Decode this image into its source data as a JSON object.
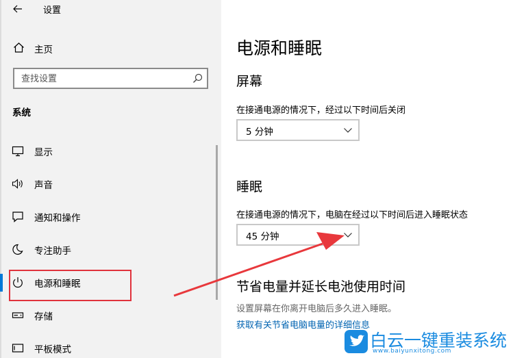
{
  "window": {
    "title": "设置"
  },
  "sidebar": {
    "home_label": "主页",
    "search_placeholder": "查找设置",
    "section_heading": "系统",
    "items": [
      {
        "label": "显示",
        "icon": "monitor-icon"
      },
      {
        "label": "声音",
        "icon": "speaker-icon"
      },
      {
        "label": "通知和操作",
        "icon": "notification-icon"
      },
      {
        "label": "专注助手",
        "icon": "moon-icon"
      },
      {
        "label": "电源和睡眠",
        "icon": "power-icon",
        "selected": true
      },
      {
        "label": "存储",
        "icon": "storage-icon"
      },
      {
        "label": "平板模式",
        "icon": "tablet-icon"
      }
    ]
  },
  "main": {
    "title": "电源和睡眠",
    "screen": {
      "heading": "屏幕",
      "description": "在接通电源的情况下，经过以下时间后关闭",
      "value": "5 分钟"
    },
    "sleep": {
      "heading": "睡眠",
      "description": "在接通电源的情况下，电脑在经过以下时间后进入睡眠状态",
      "value": "45 分钟"
    },
    "battery": {
      "heading": "节省电量并延长电池使用时间",
      "description": "设置屏幕在你离开电脑后多久进入睡眠。",
      "link": "获取有关节省电脑电量的详细信息"
    }
  },
  "watermark": {
    "text": "白云一键重装系统",
    "url": "www.baiyunxitong.com"
  },
  "colors": {
    "accent": "#0078d7",
    "annotation": "#e0323c",
    "link": "#0063b1",
    "watermark": "#1a8be0"
  }
}
